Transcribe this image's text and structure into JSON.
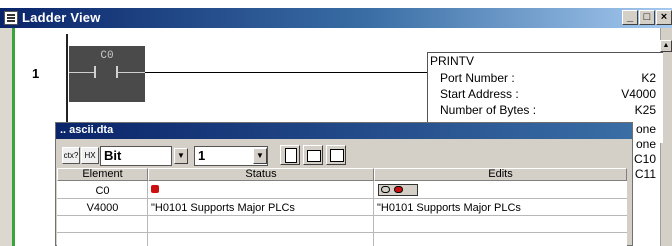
{
  "ladder_view": {
    "title": "Ladder View",
    "buttons": {
      "minimize": "_",
      "maximize": "□",
      "close": "×"
    },
    "rung": {
      "number": "1",
      "contact": "C0",
      "instruction": {
        "name": "PRINTV",
        "params": [
          {
            "label": "Port Number :",
            "value": "K2"
          },
          {
            "label": "Start Address :",
            "value": "V4000"
          },
          {
            "label": "Number of Bytes :",
            "value": "K25"
          }
        ],
        "partial_values": [
          "one",
          "one",
          "C10",
          "C11"
        ]
      }
    }
  },
  "data_window": {
    "title": ".. ascii.dta",
    "toolbar": {
      "format_value": "Bit",
      "count_value": "1"
    },
    "table": {
      "columns": [
        "Element",
        "Status",
        "Edits"
      ],
      "rows": [
        {
          "element": "C0",
          "status": "",
          "edits": ""
        },
        {
          "element": "V4000",
          "status": "\"H0101 Supports Major PLCs",
          "edits": "\"H0101 Supports Major PLCs"
        }
      ]
    }
  },
  "colors": {
    "title_active": "#0a246a",
    "rung_accent": "#3aa33a",
    "status_on": "#cc1010"
  }
}
